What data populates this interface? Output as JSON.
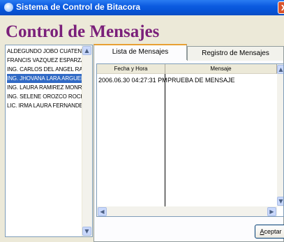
{
  "window": {
    "title": "Sistema de Control de Bitacora",
    "close_glyph": "X"
  },
  "heading": "Control de Mensajes",
  "users": {
    "items": [
      "ALDEGUNDO JOBO CUATENO",
      "FRANCIS VAZQUEZ ESPARZA",
      "ING. CARLOS DEL ANGEL RAMO",
      "ING. JHOVANA LARA ARGUELLO",
      "ING. LAURA RAMIREZ MONROY",
      "ING. SELENE OROZCO ROCHA",
      "LIC. IRMA LAURA FERNANDEZ M"
    ],
    "selected_index": 3,
    "scroll_up": "▲",
    "scroll_down": "▼"
  },
  "tabs": [
    {
      "label": "Lista de Mensajes",
      "active": true
    },
    {
      "label": "Registro de Mensajes",
      "active": false
    }
  ],
  "messages": {
    "columns": [
      "Fecha y Hora",
      "Mensaje"
    ],
    "rows": [
      {
        "fecha": "2006.06.30 04:27:31 PM",
        "mensaje": "PRUEBA DE MENSAJE"
      }
    ],
    "scroll_left": "◀",
    "scroll_right": "▶",
    "scroll_up": "▲",
    "scroll_down": "▼"
  },
  "ok_button": {
    "accel": "A",
    "rest": "ceptar"
  },
  "colors": {
    "title_bar": "#0653d6",
    "heading": "#7a1f7a",
    "selection": "#316ac5",
    "tab_highlight": "#e8a033"
  }
}
